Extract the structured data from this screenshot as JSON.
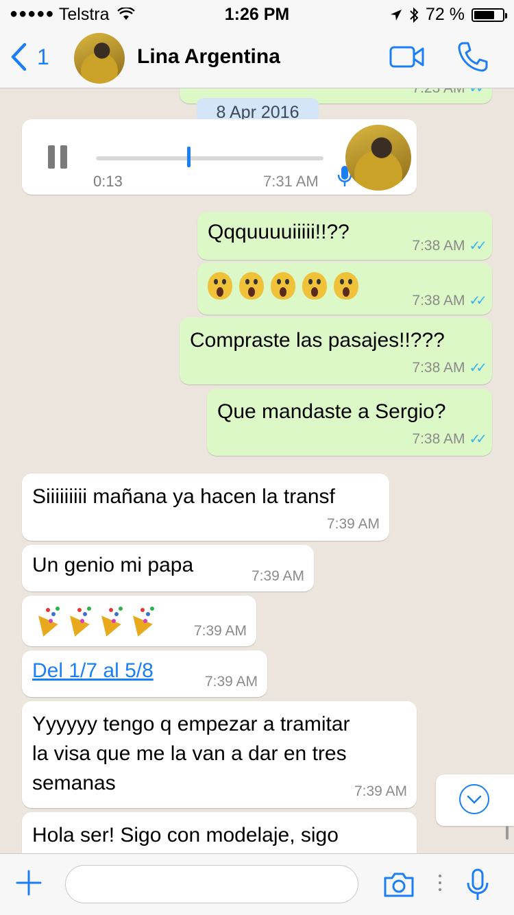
{
  "status": {
    "carrier": "Telstra",
    "signal_dots": "●●●●●",
    "time": "1:26 PM",
    "battery_text": "72 %",
    "battery_level": 0.72
  },
  "header": {
    "back_count": "1",
    "contact_name": "Lina Argentina"
  },
  "chat": {
    "date_label": "8 Apr 2016",
    "prev_time": "7:23 AM",
    "voice_note": {
      "duration": "0:13",
      "time": "7:31 AM",
      "progress": 0.4
    },
    "messages": [
      {
        "text": "Qqquuuuiiiii!!??",
        "time": "7:38 AM"
      },
      {
        "emoji": "😱😱😱😱😱",
        "time": "7:38 AM"
      },
      {
        "text": "Compraste las pasajes!!???",
        "time": "7:38 AM"
      },
      {
        "text": "Que mandaste a Sergio?",
        "time": "7:38 AM"
      },
      {
        "text": "Siiiiiiiii mañana ya hacen la transf",
        "time": "7:39 AM"
      },
      {
        "text": "Un genio mi papa",
        "time": "7:39 AM"
      },
      {
        "emoji": "🎉🎉🎉🎉",
        "time": "7:39 AM"
      },
      {
        "text": "Del 1/7 al 5/8",
        "time": "7:39 AM"
      },
      {
        "text": "Yyyyyy tengo q empezar a tramitar\nla visa que me la van a dar en tres\nsemanas",
        "time": "7:39 AM"
      },
      {
        "text": "Hola ser! Sigo con modelaje, sigo"
      }
    ]
  },
  "input": {
    "placeholder": ""
  },
  "colors": {
    "accent": "#1a7ef7",
    "outgoing": "#dcf8c6",
    "incoming": "#ffffff",
    "background": "#ece5dd"
  }
}
